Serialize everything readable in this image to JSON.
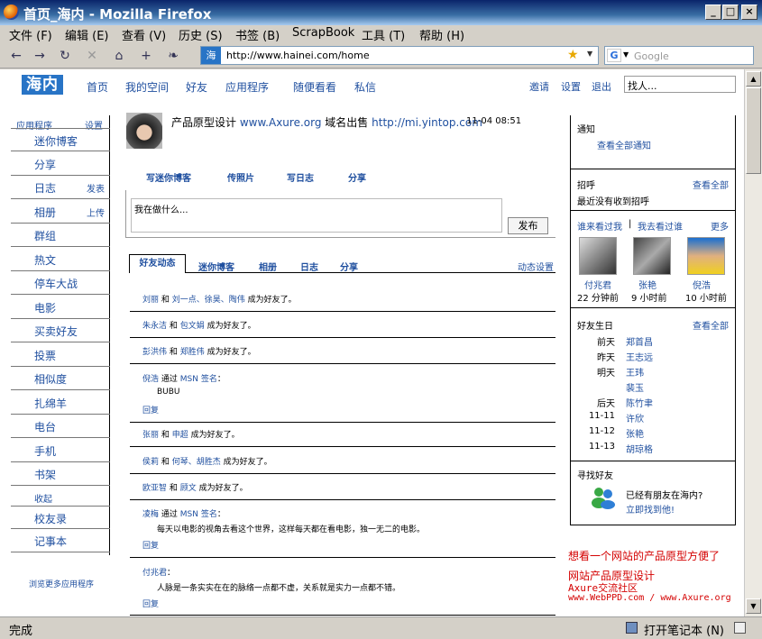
{
  "window": {
    "title": "首页_海内 - Mozilla Firefox"
  },
  "menu": [
    "文件 (F)",
    "编辑 (E)",
    "查看 (V)",
    "历史 (S)",
    "书签 (B)",
    "ScrapBook",
    "工具 (T)",
    "帮助 (H)"
  ],
  "nav": {
    "url": "http://www.hainei.com/home",
    "site_badge": "海",
    "search_placeholder": "Google",
    "search_engine_letter": "G"
  },
  "site": {
    "logo": "海内",
    "topnav": [
      "首页",
      "我的空间",
      "好友",
      "应用程序",
      "随便看看",
      "私信"
    ],
    "toplinks": [
      "邀请",
      "设置",
      "退出"
    ],
    "find_friend": "找人..."
  },
  "sidebar": {
    "header": "应用程序",
    "header_action": "设置",
    "items": [
      {
        "label": "迷你博客",
        "action": ""
      },
      {
        "label": "分享",
        "action": ""
      },
      {
        "label": "日志",
        "action": "发表"
      },
      {
        "label": "相册",
        "action": "上传"
      },
      {
        "label": "群组",
        "action": ""
      },
      {
        "label": "热文",
        "action": ""
      },
      {
        "label": "停车大战",
        "action": ""
      },
      {
        "label": "电影",
        "action": ""
      },
      {
        "label": "买卖好友",
        "action": ""
      },
      {
        "label": "投票",
        "action": ""
      },
      {
        "label": "相似度",
        "action": ""
      },
      {
        "label": "扎绵羊",
        "action": ""
      },
      {
        "label": "电台",
        "action": ""
      },
      {
        "label": "手机",
        "action": ""
      },
      {
        "label": "书架",
        "action": ""
      }
    ],
    "collapse": "收起",
    "items2": [
      {
        "label": "校友录"
      },
      {
        "label": "记事本"
      }
    ],
    "browse_more": "浏览更多应用程序"
  },
  "profile": {
    "status_prefix": "产品原型设计",
    "status_link1": "www.Axure.org",
    "status_mid": "域名出售",
    "status_link2": "http://mi.yintop.com",
    "time": "11-04 08:51"
  },
  "post_tabs": [
    "写迷你博客",
    "传照片",
    "写日志",
    "分享"
  ],
  "composer": {
    "placeholder": "我在做什么...",
    "submit": "发布"
  },
  "feed_tabs": [
    "好友动态",
    "迷你博客",
    "相册",
    "日志",
    "分享"
  ],
  "feed_settings": "动态设置",
  "feed": [
    {
      "parts": [
        {
          "t": "刘丽",
          "l": true
        },
        {
          "t": " 和 "
        },
        {
          "t": "刘一点、徐昊、陶伟",
          "l": true
        },
        {
          "t": " 成为好友了。"
        }
      ]
    },
    {
      "parts": [
        {
          "t": "朱永洁",
          "l": true
        },
        {
          "t": " 和 "
        },
        {
          "t": "包文娟",
          "l": true
        },
        {
          "t": " 成为好友了。"
        }
      ]
    },
    {
      "parts": [
        {
          "t": "彭洪伟",
          "l": true
        },
        {
          "t": " 和 "
        },
        {
          "t": "郑胜伟",
          "l": true
        },
        {
          "t": " 成为好友了。"
        }
      ]
    },
    {
      "parts": [
        {
          "t": "倪浩",
          "l": true
        },
        {
          "t": " 通过 "
        },
        {
          "t": "MSN 签名",
          "l": true
        },
        {
          "t": "："
        }
      ],
      "body": "BUBU",
      "reply": "回复"
    },
    {
      "parts": [
        {
          "t": "张丽",
          "l": true
        },
        {
          "t": " 和 "
        },
        {
          "t": "申超",
          "l": true
        },
        {
          "t": " 成为好友了。"
        }
      ]
    },
    {
      "parts": [
        {
          "t": "侯莉",
          "l": true
        },
        {
          "t": " 和 "
        },
        {
          "t": "何琴、胡胜杰",
          "l": true
        },
        {
          "t": " 成为好友了。"
        }
      ]
    },
    {
      "parts": [
        {
          "t": "欧亚智",
          "l": true
        },
        {
          "t": " 和 "
        },
        {
          "t": "顾文",
          "l": true
        },
        {
          "t": " 成为好友了。"
        }
      ]
    },
    {
      "parts": [
        {
          "t": "凌梅",
          "l": true
        },
        {
          "t": " 通过 "
        },
        {
          "t": "MSN 签名",
          "l": true
        },
        {
          "t": "："
        }
      ],
      "body": "每天以电影的视角去看这个世界，这样每天都在看电影，独一无二的电影。",
      "reply": "回复"
    },
    {
      "parts": [
        {
          "t": "付兆君",
          "l": true
        },
        {
          "t": "："
        }
      ],
      "body": "人脉是一条实实在在的脉络一点都不虚，关系就是实力一点都不错。",
      "reply": "回复"
    }
  ],
  "notice": {
    "title": "通知",
    "link": "查看全部通知"
  },
  "greet": {
    "title": "招呼",
    "view_all": "查看全部",
    "empty": "最近没有收到招呼"
  },
  "visitors": {
    "tab1": "谁来看过我",
    "sep": "|",
    "tab2": "我去看过谁",
    "more": "更多",
    "people": [
      {
        "name": "付兆君",
        "time": "22 分钟前"
      },
      {
        "name": "张艳",
        "time": "9 小时前"
      },
      {
        "name": "倪浩",
        "time": "10 小时前"
      }
    ]
  },
  "birthdays": {
    "title": "好友生日",
    "view_all": "查看全部",
    "rows": [
      {
        "day": "前天",
        "name": "郑首昌"
      },
      {
        "day": "昨天",
        "name": "王志远"
      },
      {
        "day": "明天",
        "name": "王玮"
      },
      {
        "day": "",
        "name": "裴玉"
      },
      {
        "day": "后天",
        "name": "陈竹聿"
      },
      {
        "day": "11-11",
        "name": "许欣"
      },
      {
        "day": "11-12",
        "name": "张艳"
      },
      {
        "day": "11-13",
        "name": "胡琼格"
      }
    ]
  },
  "findfriends": {
    "title": "寻找好友",
    "line1": "已经有朋友在海内?",
    "line2": "立即找到他!"
  },
  "promo": {
    "headline": "想看一个网站的产品原型方便了",
    "line1": "网站产品原型设计",
    "line2": "Axure交流社区",
    "line3": "www.WebPPD.com / www.Axure.org"
  },
  "status": {
    "text": "完成",
    "notebook": "打开笔记本 (N)"
  },
  "colors": {
    "link": "#1f4f9f",
    "brand": "#2874c6",
    "promo": "#d40000"
  }
}
